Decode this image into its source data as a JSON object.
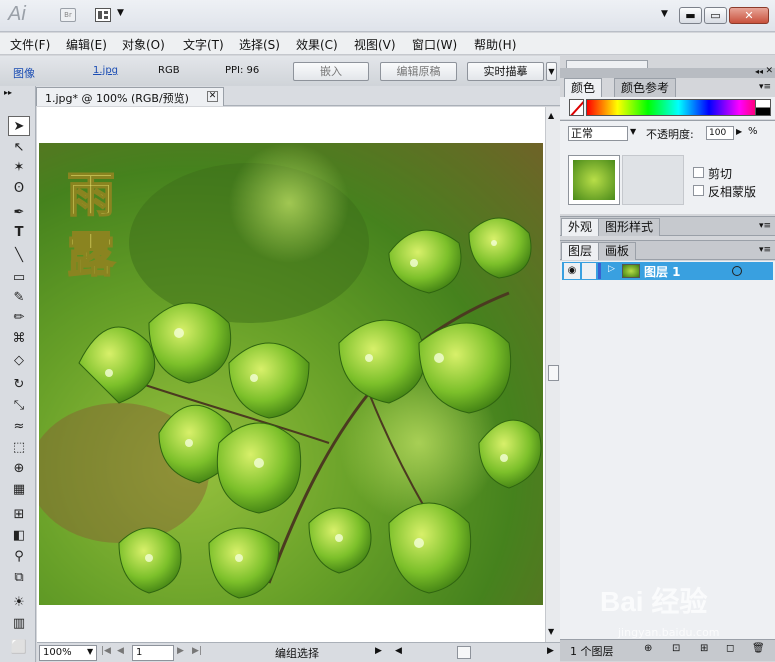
{
  "titlebar": {
    "app_logo": "Ai",
    "bridge": "Br",
    "workspace_icon": "workspace-switcher-icon",
    "min": "▬",
    "max": "▭",
    "close": "✕"
  },
  "menu": [
    "文件(F)",
    "编辑(E)",
    "对象(O)",
    "文字(T)",
    "选择(S)",
    "效果(C)",
    "视图(V)",
    "窗口(W)",
    "帮助(H)"
  ],
  "control": {
    "object_type": "图像",
    "file_link": "1.jpg",
    "color_mode": "RGB",
    "ppi_label": "PPI: 96",
    "embed_btn": "嵌入",
    "edit_original_btn": "编辑原稿",
    "live_trace_btn": "实时描摹"
  },
  "document": {
    "tab_title": "1.jpg* @ 100% (RGB/预览)",
    "close": "✕"
  },
  "artwork": {
    "calligraphy": "雨露"
  },
  "status": {
    "zoom": "100%",
    "artboard": "1",
    "mode": "编组选择"
  },
  "color_panel": {
    "tabs": [
      "颜色",
      "颜色参考"
    ]
  },
  "transparency": {
    "blend_mode": "正常",
    "opacity_label": "不透明度:",
    "opacity_value": "100",
    "percent": "%",
    "clip": "剪切",
    "invert_mask": "反相蒙版"
  },
  "appearance_panel": {
    "tabs": [
      "外观",
      "图形样式"
    ]
  },
  "layers_panel": {
    "tabs": [
      "图层",
      "画板"
    ],
    "layer_name": "图层 1",
    "footer": "1 个图层"
  },
  "watermark": {
    "brand": "Bai 经验",
    "url": "jingyan.baidu.com"
  }
}
